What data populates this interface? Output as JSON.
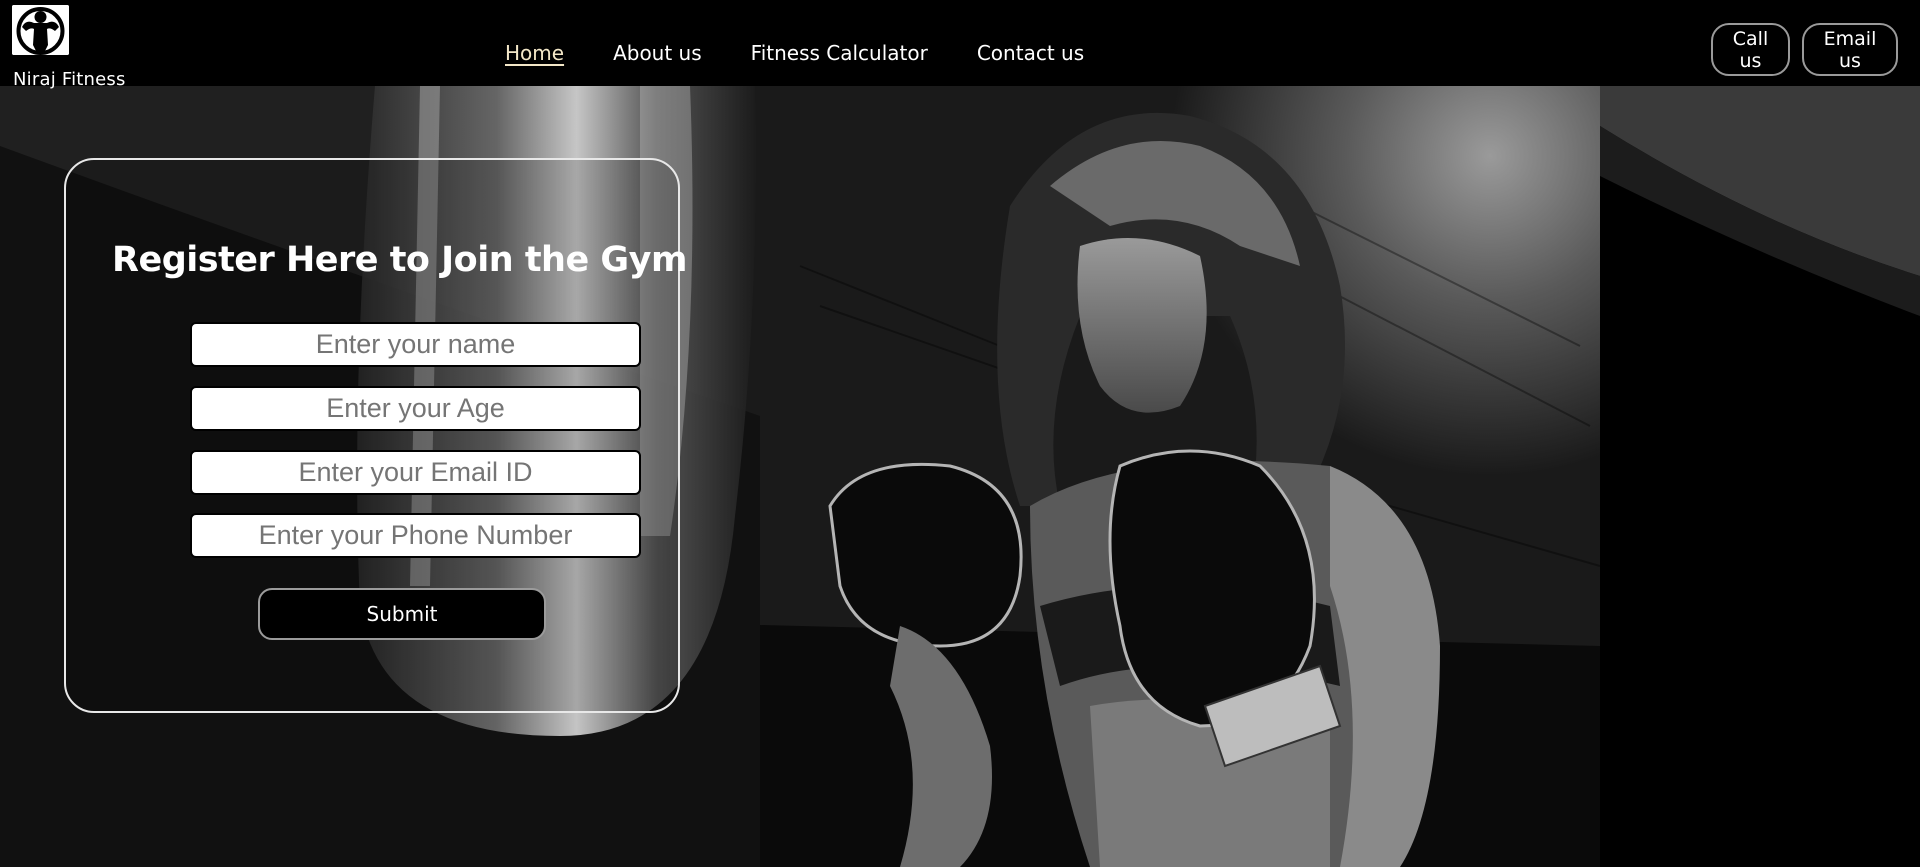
{
  "brand": {
    "name": "Niraj Fitness",
    "logo_icon": "muscle-man-logo-icon"
  },
  "nav": {
    "items": [
      {
        "label": "Home",
        "active": true
      },
      {
        "label": "About us",
        "active": false
      },
      {
        "label": "Fitness Calculator",
        "active": false
      },
      {
        "label": "Contact us",
        "active": false
      }
    ],
    "call_label": "Call us",
    "email_label": "Email us"
  },
  "register": {
    "title": "Register Here to Join the Gym",
    "fields": {
      "name_placeholder": "Enter your name",
      "age_placeholder": "Enter your Age",
      "email_placeholder": "Enter your Email ID",
      "phone_placeholder": "Enter your Phone Number"
    },
    "submit_label": "Submit"
  },
  "colors": {
    "background": "#000000",
    "nav_active": "#f3e7c8",
    "text": "#ffffff"
  }
}
